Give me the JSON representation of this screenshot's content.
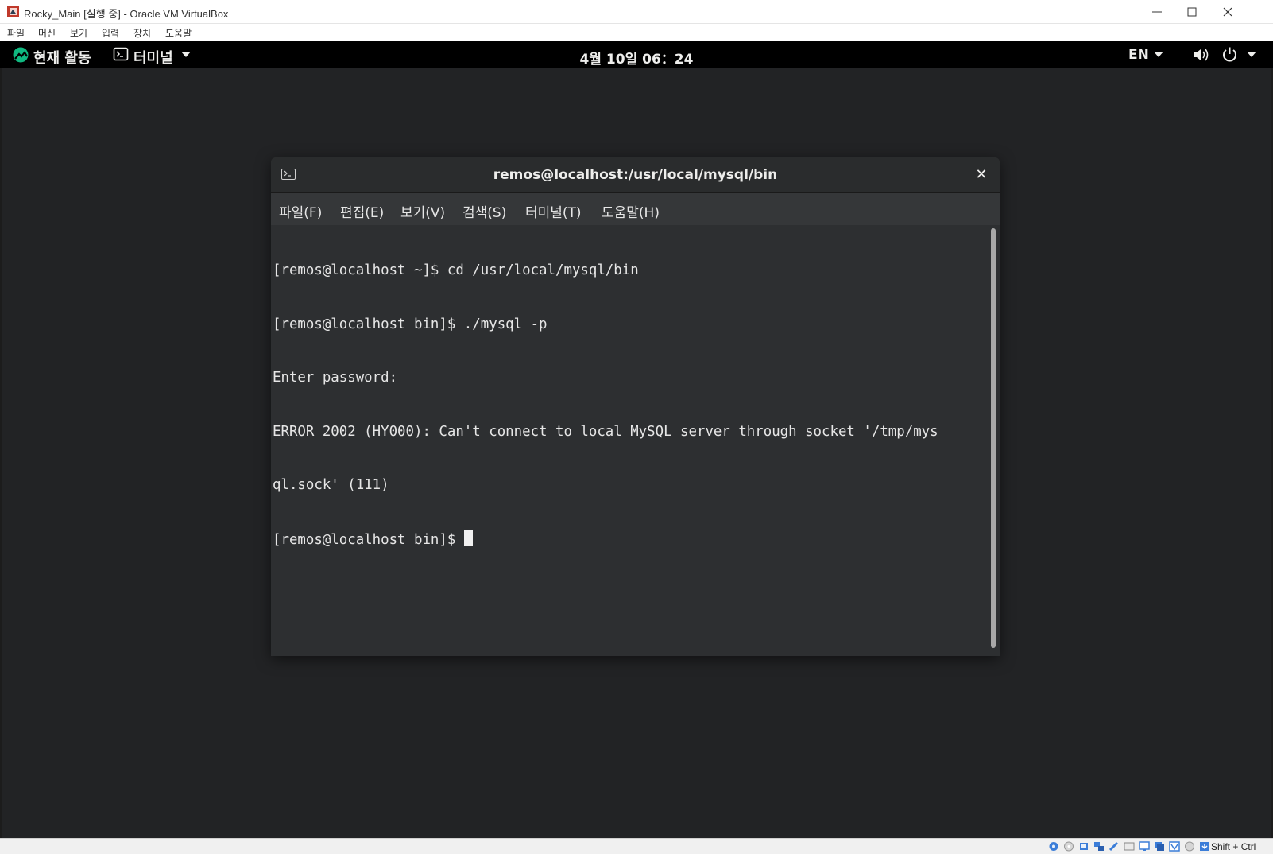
{
  "vbox": {
    "title": "Rocky_Main [실행 중] - Oracle VM VirtualBox",
    "menu": [
      "파일",
      "머신",
      "보기",
      "입력",
      "장치",
      "도움말"
    ],
    "host_key": "Shift + Ctrl"
  },
  "gnome": {
    "activities": "현재 활동",
    "app_menu": "터미널",
    "clock": "4월 10일 06：24",
    "input_method": "EN"
  },
  "terminal": {
    "title": "remos@localhost:/usr/local/mysql/bin",
    "menu": [
      "파일(F)",
      "편집(E)",
      "보기(V)",
      "검색(S)",
      "터미널(T)",
      "도움말(H)"
    ],
    "lines": [
      "[remos@localhost ~]$ cd /usr/local/mysql/bin",
      "[remos@localhost bin]$ ./mysql -p",
      "Enter password:",
      "ERROR 2002 (HY000): Can't connect to local MySQL server through socket '/tmp/mys",
      "ql.sock' (111)"
    ],
    "prompt": "[remos@localhost bin]$ "
  },
  "colors": {
    "guest_bg": "#222325",
    "topbar_bg": "#000000",
    "terminal_bg": "#2d2f31",
    "rocky_logo": "#10b981"
  }
}
